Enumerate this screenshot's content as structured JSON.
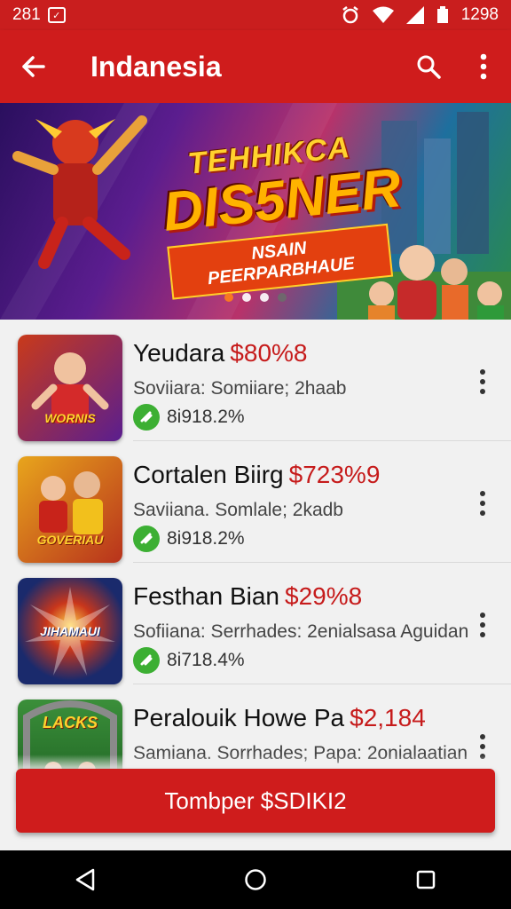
{
  "status_bar": {
    "time_left": "281",
    "time_right": "1298"
  },
  "app_bar": {
    "title": "Indanesia",
    "icons": [
      "back-arrow-icon",
      "search-icon",
      "more-vert-icon"
    ]
  },
  "banner": {
    "line1": "TEHHIKCA",
    "line2": "DIS5NER",
    "line3": "NSAIN PEERPARBHAUE",
    "dots": 4,
    "active_dot": 0
  },
  "items": [
    {
      "title": "Yeudara",
      "price": "$80%8",
      "subtitle": "Soviiara: Somiiare; 2haab",
      "rating": "8i918.2%",
      "thumb_text": "WORNIS",
      "thumb_colors": [
        "#c93a1a",
        "#5a1e8f"
      ]
    },
    {
      "title": "Cortalen Biirg",
      "price": "$723%9",
      "subtitle": "Saviiana. Somlale; 2kadb",
      "rating": "8i918.2%",
      "thumb_text": "GOVERIAU",
      "thumb_colors": [
        "#e8a51c",
        "#b8321c"
      ]
    },
    {
      "title": "Festhan Bian",
      "price": "$29%8",
      "subtitle": "Sofiiana: Serrhades: 2enialsasa Aguidan",
      "rating": "8i718.4%",
      "thumb_text": "JIHAMAUI",
      "thumb_colors": [
        "#1a2a6c",
        "#c9361b"
      ]
    },
    {
      "title": "Peralouik Howe Pa",
      "price": "$2,184",
      "subtitle": "Samiana. Sorrhades; Papa: 2onialaatian",
      "rating": "",
      "thumb_text": "LACKS",
      "thumb_colors": [
        "#2e7d32",
        "#1b5e20"
      ]
    }
  ],
  "cta": {
    "label": "Tombper $SDIKI2"
  },
  "colors": {
    "primary": "#cf1c1c",
    "price": "#c61b1b",
    "rating_green": "#3caf33"
  }
}
